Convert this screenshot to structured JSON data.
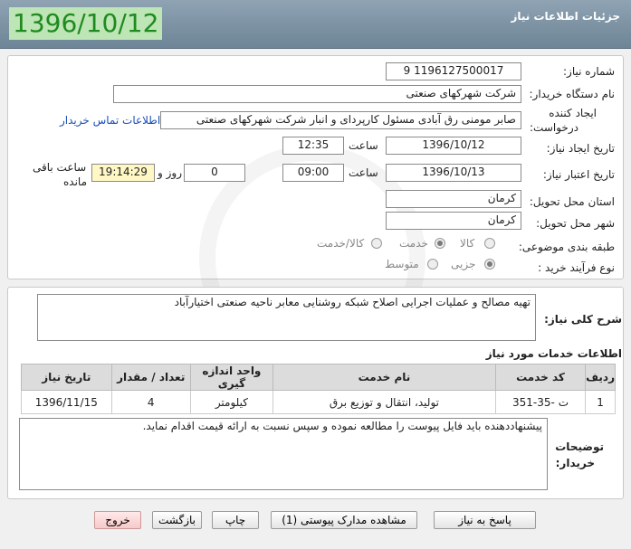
{
  "header": {
    "title": "جزئیات اطلاعات نیاز",
    "date": "1396/10/12"
  },
  "form": {
    "need_number_label": "شماره نیاز:",
    "need_number": "1196127500017 9",
    "buyer_org_label": "نام دستگاه خریدار:",
    "buyer_org": "شرکت شهرکهای صنعتی",
    "creator_label_1": "ایجاد کننده",
    "creator_label_2": "درخواست:",
    "creator": "صابر مومنی رق آبادی مسئول کارپردای و انبار شرکت شهرکهای صنعتی",
    "contact_link": "اطلاعات تماس خریدار",
    "create_date_label": "تاریخ ایجاد نیاز:",
    "create_date": "1396/10/12",
    "time_label": "ساعت",
    "create_time": "12:35",
    "valid_date_label": "تاریخ اعتبار نیاز:",
    "valid_date": "1396/10/13",
    "valid_time": "09:00",
    "days_value": "0",
    "days_label": "روز و",
    "remaining_time": "19:14:29",
    "remaining_label_1": "ساعت باقی",
    "remaining_label_2": "مانده",
    "province_label": "استان محل تحویل:",
    "province": "کرمان",
    "city_label": "شهر محل تحویل:",
    "city": "کرمان",
    "category_label": "طبقه بندی موضوعی:",
    "category_options": [
      "کالا",
      "خدمت",
      "کالا/خدمت"
    ],
    "category_selected": "خدمت",
    "process_label": "نوع فرآیند خرید :",
    "process_options": [
      "جزیی",
      "متوسط"
    ],
    "process_selected": "جزیی"
  },
  "summary": {
    "label": "شرح کلی نیاز:",
    "text": "تهیه مصالح و عملیات اجرایی اصلاح شبکه روشنایی معابر ناحیه صنعتی اختیارآباد"
  },
  "services": {
    "section_title": "اطلاعات خدمات مورد نیاز",
    "columns": [
      "ردیف",
      "کد خدمت",
      "نام خدمت",
      "واحد اندازه گیری",
      "تعداد / مقدار",
      "تاریخ نیاز"
    ],
    "rows": [
      [
        "1",
        "ت -35-351",
        "تولید، انتقال و توزیع برق",
        "کیلومتر",
        "4",
        "1396/11/15"
      ]
    ]
  },
  "buyer_notes": {
    "label_1": "توضیحات",
    "label_2": "خریدار:",
    "text": "پیشنهاددهنده باید فایل پیوست را مطالعه نموده و سپس نسبت به ارائه قیمت اقدام نماید."
  },
  "buttons": {
    "reply": "پاسخ به نیاز",
    "attachments": "مشاهده مدارک پیوستی (1)",
    "print": "چاپ",
    "back": "بازگشت",
    "exit": "خروج"
  }
}
